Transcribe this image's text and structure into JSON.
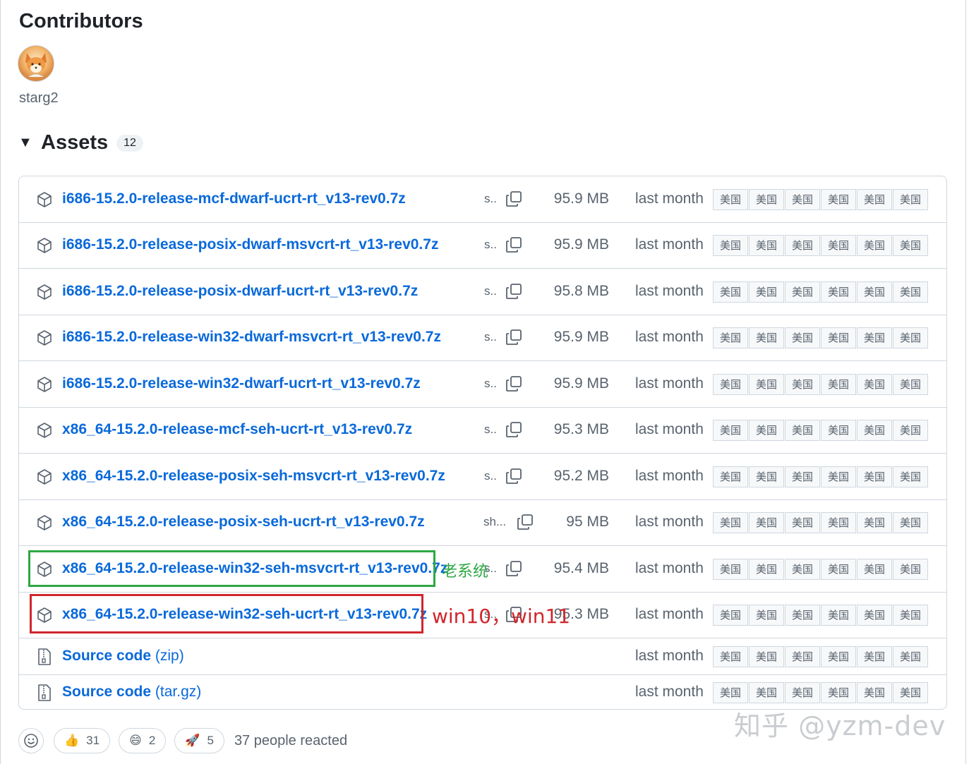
{
  "contributors": {
    "title": "Contributors",
    "name": "starg2"
  },
  "assets": {
    "title": "Assets",
    "count": "12",
    "mirror_label": "美国",
    "rows": [
      {
        "name": "i686-15.2.0-release-mcf-dwarf-ucrt-rt_v13-rev0.7z",
        "sha": "s..",
        "size": "95.9 MB",
        "date": "last month"
      },
      {
        "name": "i686-15.2.0-release-posix-dwarf-msvcrt-rt_v13-rev0.7z",
        "sha": "s..",
        "size": "95.9 MB",
        "date": "last month"
      },
      {
        "name": "i686-15.2.0-release-posix-dwarf-ucrt-rt_v13-rev0.7z",
        "sha": "s..",
        "size": "95.8 MB",
        "date": "last month"
      },
      {
        "name": "i686-15.2.0-release-win32-dwarf-msvcrt-rt_v13-rev0.7z",
        "sha": "s..",
        "size": "95.9 MB",
        "date": "last month"
      },
      {
        "name": "i686-15.2.0-release-win32-dwarf-ucrt-rt_v13-rev0.7z",
        "sha": "s..",
        "size": "95.9 MB",
        "date": "last month"
      },
      {
        "name": "x86_64-15.2.0-release-mcf-seh-ucrt-rt_v13-rev0.7z",
        "sha": "s..",
        "size": "95.3 MB",
        "date": "last month"
      },
      {
        "name": "x86_64-15.2.0-release-posix-seh-msvcrt-rt_v13-rev0.7z",
        "sha": "s..",
        "size": "95.2 MB",
        "date": "last month"
      },
      {
        "name": "x86_64-15.2.0-release-posix-seh-ucrt-rt_v13-rev0.7z",
        "sha": "sh...",
        "size": "95 MB",
        "date": "last month"
      },
      {
        "name": "x86_64-15.2.0-release-win32-seh-msvcrt-rt_v13-rev0.7z",
        "sha": "s..",
        "size": "95.4 MB",
        "date": "last month"
      },
      {
        "name": "x86_64-15.2.0-release-win32-seh-ucrt-rt_v13-rev0.7z",
        "sha": "s..",
        "size": "95.3 MB",
        "date": "last month"
      }
    ],
    "source_rows": [
      {
        "name": "Source code",
        "ext": "(zip)",
        "date": "last month"
      },
      {
        "name": "Source code",
        "ext": "(tar.gz)",
        "date": "last month"
      }
    ]
  },
  "annotations": {
    "green_note": "老系统",
    "red_note": "win10，win11",
    "green_color": "#2ea843",
    "red_color": "#d0262c"
  },
  "reactions": {
    "items": [
      {
        "emoji": "👍",
        "count": "31"
      },
      {
        "emoji": "😄",
        "count": "2"
      },
      {
        "emoji": "🚀",
        "count": "5"
      }
    ],
    "summary": "37 people reacted"
  },
  "watermark": "知乎 @yzm-dev",
  "colors": {
    "link": "#0969da",
    "muted": "#59636e",
    "border": "#d0d7de"
  }
}
